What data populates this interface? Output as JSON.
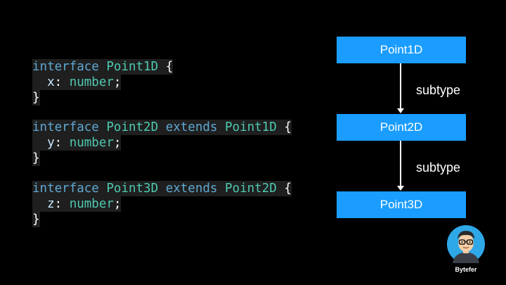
{
  "code": {
    "block1": {
      "kw": "interface",
      "name": "Point1D",
      "open": "{",
      "prop": "x",
      "type": "number",
      "semi": ";",
      "close": "}"
    },
    "block2": {
      "kw": "interface",
      "name": "Point2D",
      "extends_kw": "extends",
      "parent": "Point1D",
      "open": "{",
      "prop": "y",
      "type": "number",
      "semi": ";",
      "close": "}"
    },
    "block3": {
      "kw": "interface",
      "name": "Point3D",
      "extends_kw": "extends",
      "parent": "Point2D",
      "open": "{",
      "prop": "z",
      "type": "number",
      "semi": ";",
      "close": "}"
    }
  },
  "diagram": {
    "nodes": [
      "Point1D",
      "Point2D",
      "Point3D"
    ],
    "edge_labels": [
      "subtype",
      "subtype"
    ],
    "node_color": "#1a9dff"
  },
  "brand": {
    "name": "Bytefer",
    "avatar_bg": "#2fa8e8"
  },
  "colors": {
    "keyword": "#5fa8d3",
    "type": "#4ec9b0",
    "background": "#000000"
  }
}
